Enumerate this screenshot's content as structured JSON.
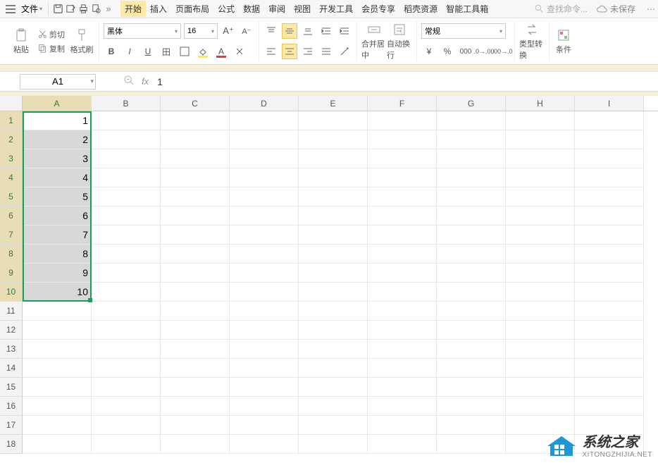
{
  "menubar": {
    "file_label": "文件",
    "tabs": [
      "开始",
      "插入",
      "页面布局",
      "公式",
      "数据",
      "审阅",
      "视图",
      "开发工具",
      "会员专享",
      "稻壳资源",
      "智能工具箱"
    ],
    "active_tab": 0,
    "search_placeholder": "查找命令...",
    "unsaved_label": "未保存"
  },
  "ribbon": {
    "paste_label": "粘贴",
    "cut_label": "剪切",
    "copy_label": "复制",
    "format_painter_label": "格式刷",
    "font_name": "黑体",
    "font_size": "16",
    "bold": "B",
    "italic": "I",
    "underline": "U",
    "merge_center_label": "合并居中",
    "wrap_text_label": "自动换行",
    "number_format": "常规",
    "currency_sym": "¥",
    "percent_sym": "%",
    "type_convert_label": "类型转换",
    "condition_label": "条件"
  },
  "namebox": {
    "value": "A1"
  },
  "formula": {
    "value": "1"
  },
  "grid": {
    "columns": [
      "A",
      "B",
      "C",
      "D",
      "E",
      "F",
      "G",
      "H",
      "I"
    ],
    "row_count": 18,
    "selected_col": 0,
    "selection": {
      "row_start": 1,
      "row_end": 10
    },
    "data": {
      "A": [
        "1",
        "2",
        "3",
        "4",
        "5",
        "6",
        "7",
        "8",
        "9",
        "10"
      ]
    }
  },
  "watermark": {
    "title": "系统之家",
    "subtitle": "XITONGZHIJIA.NET"
  }
}
